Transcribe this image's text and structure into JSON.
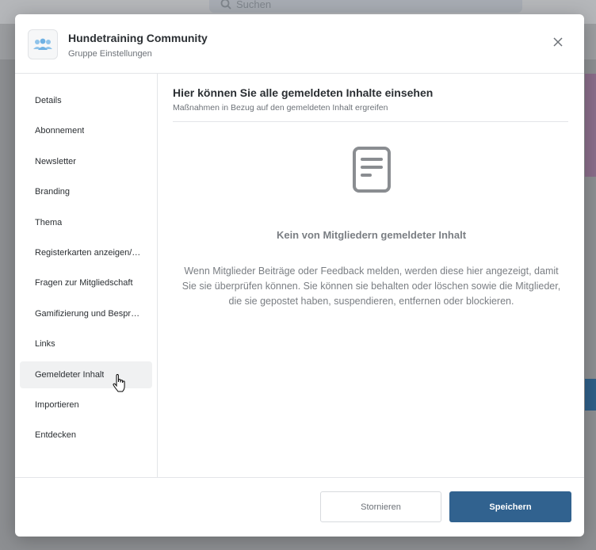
{
  "background": {
    "search_placeholder": "Suchen"
  },
  "header": {
    "group_name": "Hundetraining Community",
    "subtitle": "Gruppe Einstellungen"
  },
  "sidebar": {
    "items": [
      {
        "label": "Details"
      },
      {
        "label": "Abonnement"
      },
      {
        "label": "Newsletter"
      },
      {
        "label": "Branding"
      },
      {
        "label": "Thema"
      },
      {
        "label": "Registerkarten anzeigen/…"
      },
      {
        "label": "Fragen zur Mitgliedschaft"
      },
      {
        "label": "Gamifizierung und Bespre…"
      },
      {
        "label": "Links"
      },
      {
        "label": "Gemeldeter Inhalt"
      },
      {
        "label": "Importieren"
      },
      {
        "label": "Entdecken"
      }
    ],
    "active_index": 9
  },
  "content": {
    "title": "Hier können Sie alle gemeldeten Inhalte einsehen",
    "subtitle": "Maßnahmen in Bezug auf den gemeldeten Inhalt ergreifen",
    "empty_icon": "document-icon",
    "empty_title": "Kein von Mitgliedern gemeldeter Inhalt",
    "empty_description": "Wenn Mitglieder Beiträge oder Feedback melden, werden diese hier angezeigt, damit Sie sie überprüfen können. Sie können sie behalten oder löschen sowie die Mitglieder, die sie gepostet haben, suspendieren, entfernen oder blockieren."
  },
  "footer": {
    "cancel_label": "Stornieren",
    "save_label": "Speichern"
  },
  "colors": {
    "primary": "#31628f",
    "active_bg": "#f0f1f2",
    "muted_text": "#7a7e83"
  }
}
